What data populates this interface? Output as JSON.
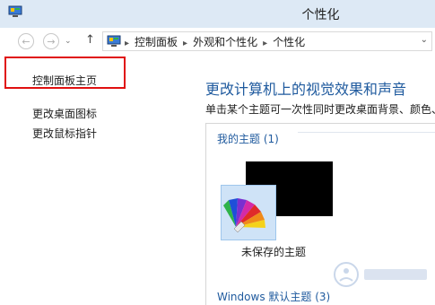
{
  "window": {
    "title": "个性化"
  },
  "nav": {
    "back_glyph": "←",
    "forward_glyph": "→",
    "up_glyph": "↑",
    "breadcrumbs": [
      "控制面板",
      "外观和个性化",
      "个性化"
    ],
    "separator_glyph": "▸",
    "dropdown_glyph": "⌄"
  },
  "sidebar": {
    "items": [
      {
        "label": "控制面板主页"
      },
      {
        "label": "更改桌面图标"
      },
      {
        "label": "更改鼠标指针"
      }
    ]
  },
  "main": {
    "heading": "更改计算机上的视觉效果和声音",
    "description": "单击某个主题可一次性同时更改桌面背景、颜色、",
    "groups": [
      {
        "label": "我的主题 (1)"
      },
      {
        "label": "Windows 默认主题 (3)"
      }
    ],
    "theme": {
      "name": "未保存的主题"
    }
  },
  "colors": {
    "accent_link": "#1f5a9e",
    "highlight_box": "#e01010",
    "titlebar": "#dde9f5"
  }
}
